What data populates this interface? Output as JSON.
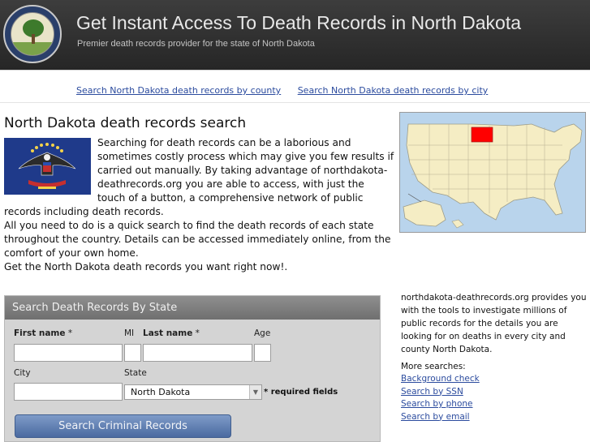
{
  "header": {
    "title": "Get Instant Access To Death Records in North Dakota",
    "subtitle": "Premier death records provider for the state of North Dakota"
  },
  "nav": {
    "links": [
      "Search North Dakota death records by county",
      "Search North Dakota death records by city"
    ]
  },
  "main": {
    "heading": "North Dakota death records search",
    "paragraphs": [
      "Searching for death records can be a laborious and sometimes costly process which may give you few results if carried out manually. By taking advantage of northdakota-deathrecords.org you are able to access, with just the touch of a button, a comprehensive network of public records including death records.",
      "All you need to do is a quick search to find the death records of each state throughout the country. Details can be accessed immediately online, from the comfort of your own home.",
      "Get the North Dakota death records you want right now!."
    ]
  },
  "search": {
    "title": "Search Death Records By State",
    "first_name_label": "First name",
    "mi_label": "MI",
    "last_name_label": "Last name",
    "age_label": "Age",
    "city_label": "City",
    "state_label": "State",
    "state_value": "North Dakota",
    "required_note": "* required fields",
    "asterisk": "*",
    "button_label": "Search Criminal Records"
  },
  "sidebar": {
    "description": "northdakota-deathrecords.org provides you with the tools to investigate millions of public records for the details you are looking for on deaths in every city and county North Dakota.",
    "more_label": "More searches:",
    "links": [
      "Background check",
      "Search by SSN",
      "Search by phone",
      "Search by email"
    ]
  },
  "colors": {
    "header_bg": "#2f2f2f",
    "link": "#2b4b9e",
    "button": "#5d7bb0",
    "map_highlight": "#ff0000"
  }
}
